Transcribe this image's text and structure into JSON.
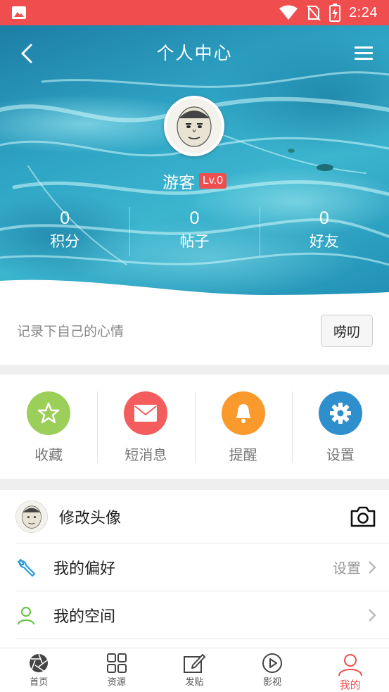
{
  "status_bar": {
    "time": "2:24",
    "icons": [
      "image-icon",
      "wifi-icon",
      "no-sim-icon",
      "battery-charging-icon"
    ]
  },
  "header": {
    "title": "个人中心",
    "back_icon": "back-arrow-icon",
    "menu_icon": "hamburger-menu-icon"
  },
  "profile": {
    "username": "游客",
    "level": "Lv.0",
    "stats": [
      {
        "value": "0",
        "label": "积分"
      },
      {
        "value": "0",
        "label": "帖子"
      },
      {
        "value": "0",
        "label": "好友"
      }
    ]
  },
  "mood": {
    "placeholder": "记录下自己的心情",
    "button": "唠叨"
  },
  "quick_actions": [
    {
      "label": "收藏",
      "icon": "star-icon",
      "color": "#9ccf5a"
    },
    {
      "label": "短消息",
      "icon": "envelope-icon",
      "color": "#f45d5d"
    },
    {
      "label": "提醒",
      "icon": "bell-icon",
      "color": "#fa9a2c"
    },
    {
      "label": "设置",
      "icon": "gear-icon",
      "color": "#2f8fcd"
    }
  ],
  "menu_list": [
    {
      "label": "修改头像",
      "value": "",
      "icon": "camera-icon"
    },
    {
      "label": "我的偏好",
      "value": "设置",
      "icon": "wrench-icon"
    },
    {
      "label": "我的空间",
      "value": "",
      "icon": "user-icon"
    }
  ],
  "tabbar": {
    "active": 4,
    "items": [
      {
        "label": "首页",
        "icon": "aperture-icon"
      },
      {
        "label": "资源",
        "icon": "grid-icon"
      },
      {
        "label": "发贴",
        "icon": "edit-icon"
      },
      {
        "label": "影视",
        "icon": "play-icon"
      },
      {
        "label": "我的",
        "icon": "user-icon"
      }
    ]
  },
  "colors": {
    "accent": "#f04e4e",
    "hero": "#2ea3c4"
  }
}
